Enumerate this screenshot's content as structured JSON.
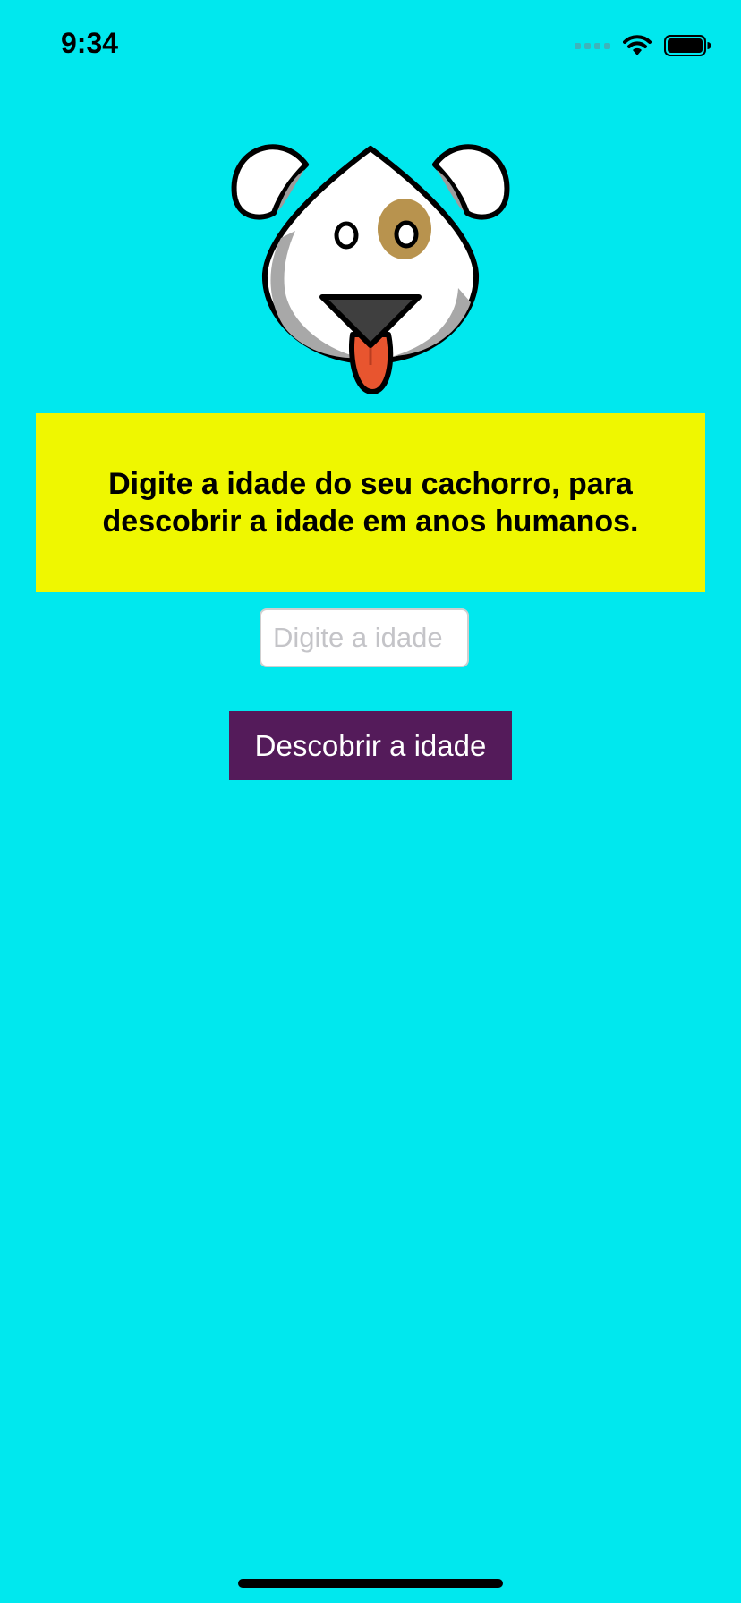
{
  "status_bar": {
    "time": "9:34",
    "icons": [
      "cellular-signal-icon",
      "wifi-icon",
      "battery-icon"
    ]
  },
  "logo": {
    "icon": "dog-face-icon"
  },
  "banner": {
    "text": "Digite a idade do seu cachorro, para descobrir a idade em anos humanos."
  },
  "age_input": {
    "placeholder": "Digite a idade",
    "value": ""
  },
  "submit_button": {
    "label": "Descobrir a idade"
  },
  "colors": {
    "background": "#00E8EE",
    "banner": "#EFF700",
    "button": "#541B5A",
    "button_text": "#FFFFFF",
    "nose": "#3F3F3F",
    "tongue": "#E8552F",
    "eye_patch": "#B8934E"
  }
}
